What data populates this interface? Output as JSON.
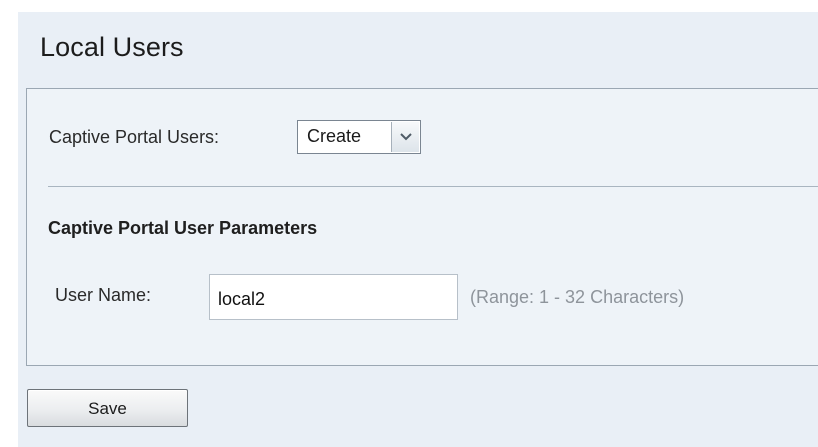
{
  "page": {
    "title": "Local Users"
  },
  "captive_portal": {
    "users_label": "Captive Portal Users:",
    "users_selected": "Create"
  },
  "parameters": {
    "section_title": "Captive Portal User Parameters",
    "username_label": "User Name:",
    "username_value": "local2",
    "username_hint": "(Range: 1 - 32 Characters)"
  },
  "actions": {
    "save_label": "Save"
  },
  "icons": {
    "dropdown": "chevron-down-icon"
  },
  "colors": {
    "page_background": "#e9eff6",
    "panel_background": "#eef3f8",
    "hint_text": "#8e949b"
  }
}
